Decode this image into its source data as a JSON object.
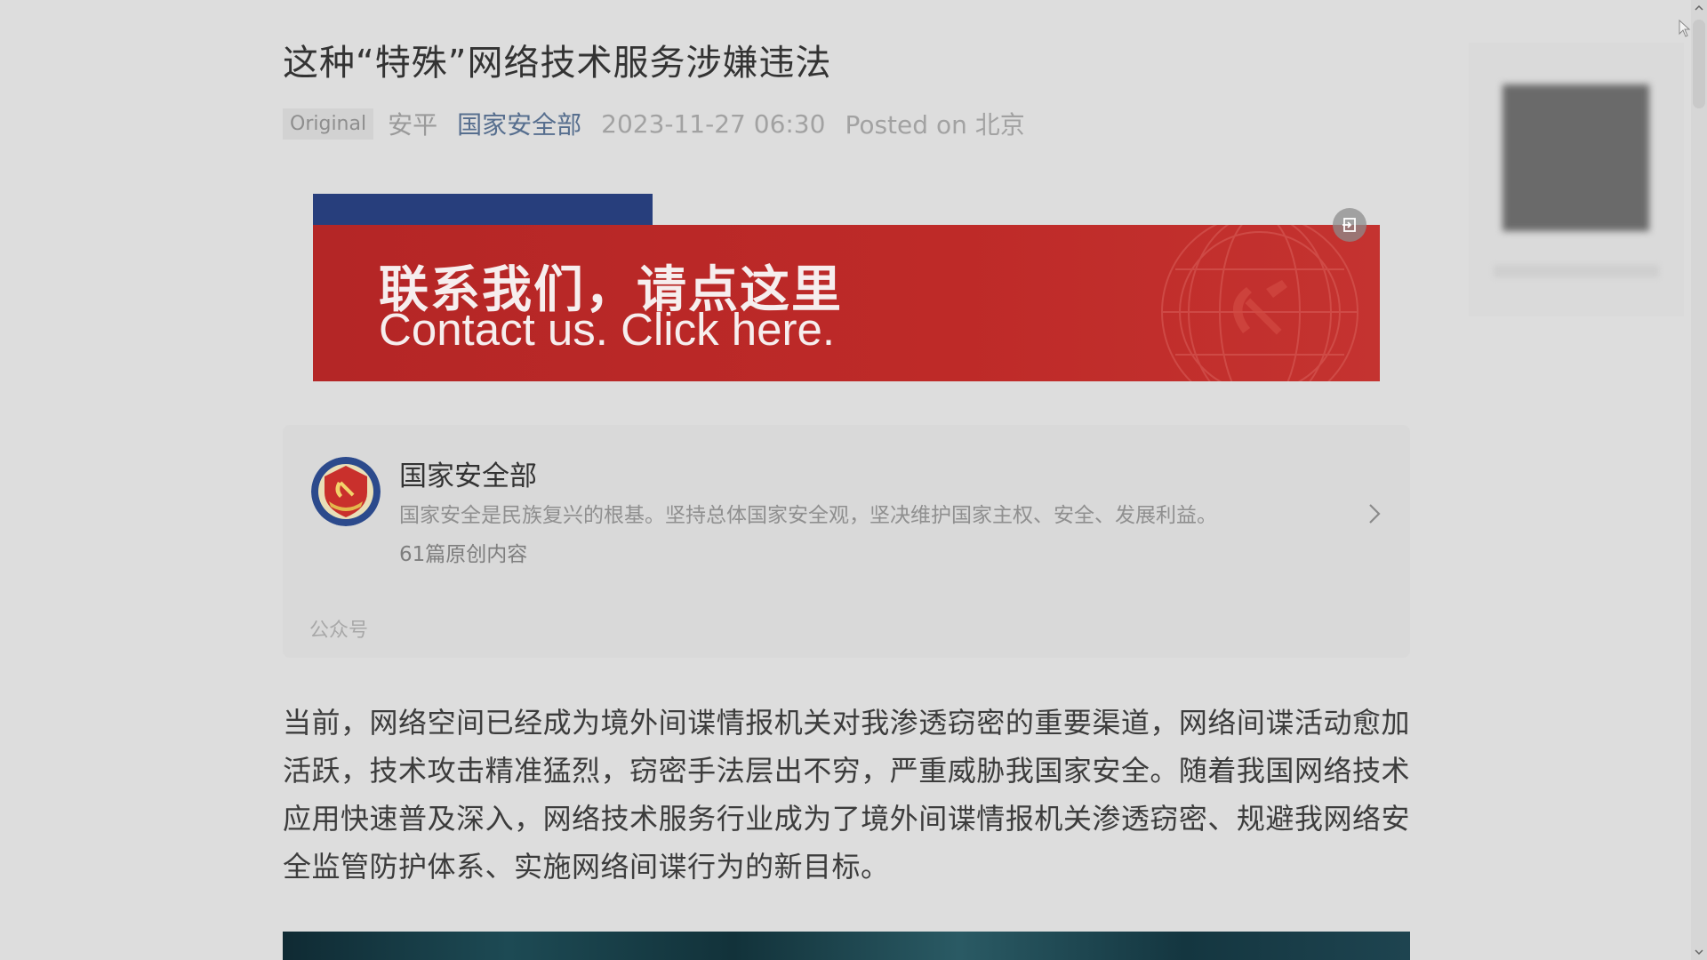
{
  "article": {
    "title": "这种“特殊”网络技术服务涉嫌违法",
    "meta": {
      "tag": "Original",
      "author": "安平",
      "account": "国家安全部",
      "date": "2023-11-27 06:30",
      "location": "Posted on 北京"
    },
    "banner": {
      "cn": "联系我们，请点这里",
      "en": "Contact us. Click here."
    },
    "account_card": {
      "name": "国家安全部",
      "description": "国家安全是民族复兴的根基。坚持总体国家安全观，坚决维护国家主权、安全、发展利益。",
      "count": "61篇原创内容",
      "footer": "公众号"
    },
    "paragraph": "当前，网络空间已经成为境外间谍情报机关对我渗透窃密的重要渠道，网络间谍活动愈加活跃，技术攻击精准猛烈，窃密手法层出不穷，严重威胁我国家安全。随着我国网络技术应用快速普及深入，网络技术服务行业成为了境外间谍情报机关渗透窃密、规避我网络安全监管防护体系、实施网络间谍行为的新目标。"
  },
  "icons": {
    "banner_corner": "exit-icon",
    "card_arrow": "chevron-right-icon",
    "avatar": "emblem-icon"
  },
  "colors": {
    "banner_red": "#be2a28",
    "banner_blue": "#273e7c",
    "account_link": "#566e8e"
  }
}
